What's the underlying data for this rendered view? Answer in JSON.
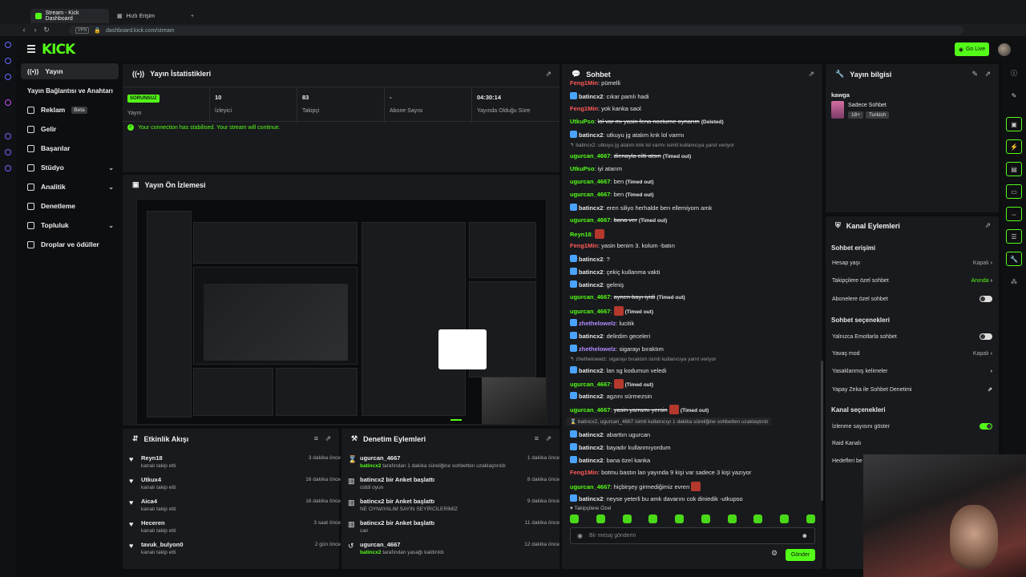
{
  "browser": {
    "tabs": [
      "Stream - Kick Dashboard",
      "Hızlı Erişim"
    ],
    "url_secure": "VPN",
    "url": "dashboard.kick.com/stream"
  },
  "header": {
    "logo": "KICK",
    "go_live": "Go Live"
  },
  "nav": {
    "items": [
      {
        "label": "Yayın",
        "active": true
      },
      {
        "label": "Yayın Bağlantısı ve Anahtarı"
      },
      {
        "label": "Reklam",
        "badge": "Beta"
      },
      {
        "label": "Gelir"
      },
      {
        "label": "Başarılar"
      },
      {
        "label": "Stüdyo"
      },
      {
        "label": "Analitik"
      },
      {
        "label": "Denetleme"
      },
      {
        "label": "Topluluk"
      },
      {
        "label": "Droplar ve ödüller"
      }
    ]
  },
  "stats": {
    "title": "Yayın İstatistikleri",
    "items": [
      {
        "value": "SORUNSUZ",
        "label": "Yayın"
      },
      {
        "value": "10",
        "label": "İzleyici"
      },
      {
        "value": "83",
        "label": "Takipçi"
      },
      {
        "value": "-",
        "label": "Abone Sayısı"
      },
      {
        "value": "04:30:14",
        "label": "Yayında Olduğu Süre"
      }
    ],
    "notice": "Your connection has stabilised. Your stream will continue."
  },
  "preview": {
    "title": "Yayın Ön İzlemesi"
  },
  "chat": {
    "title": "Sohbet",
    "messages": [
      {
        "user": "Feng1Min",
        "text": "pümelli",
        "color": "#ff5a5a"
      },
      {
        "user": "batincx2",
        "text": "cıkar pamlı hadi",
        "color": "#e5e5e5",
        "badge": true
      },
      {
        "user": "Feng1Min",
        "text": "yok kanka saol",
        "color": "#ff5a5a"
      },
      {
        "user": "UtkuPso",
        "text": "lol var mı yasin fena nocturne oynarım",
        "color": "#53fc18",
        "strike": true,
        "tag": "(Deleted)"
      },
      {
        "user": "batincx2",
        "text": "utkuyu jg atalım knk lol varmı",
        "color": "#e5e5e5",
        "badge": true
      },
      {
        "reply": "batincx2: utkuyu jg atalım knk lol varmı isimli kullanıcıya yanıt veriyor"
      },
      {
        "user": "ugurcan_4667",
        "text": "dienayla cilti atsın",
        "color": "#53fc18",
        "strike": true,
        "tag": "(Timed out)"
      },
      {
        "user": "UtkuPso",
        "text": "iyi atarım",
        "color": "#53fc18"
      },
      {
        "user": "ugurcan_4667",
        "text": "ben",
        "color": "#53fc18",
        "tag": "(Timed out)"
      },
      {
        "user": "ugurcan_4667",
        "text": "ben",
        "color": "#53fc18",
        "tag": "(Timed out)"
      },
      {
        "user": "batincx2",
        "text": "eren siliyo herhalde ben ellemiyom amk",
        "color": "#e5e5e5",
        "badge": true
      },
      {
        "user": "ugurcan_4667",
        "text": "bana ver",
        "color": "#53fc18",
        "strike": true,
        "tag": "(Timed out)"
      },
      {
        "user": "Reyn18",
        "text": "",
        "color": "#53fc18",
        "emote": true
      },
      {
        "user": "Feng1Min",
        "text": "yasin benim 3. kolum -batın",
        "color": "#ff5a5a"
      },
      {
        "user": "batincx2",
        "text": "?",
        "color": "#e5e5e5",
        "badge": true
      },
      {
        "user": "batincx2",
        "text": "çekiç kullanma vakti",
        "color": "#e5e5e5",
        "badge": true
      },
      {
        "user": "batincx2",
        "text": "gelmiş",
        "color": "#e5e5e5",
        "badge": true
      },
      {
        "user": "ugurcan_4667",
        "text": "aynen bayı iyidi",
        "color": "#53fc18",
        "strike": true,
        "tag": "(Timed out)"
      },
      {
        "user": "ugurcan_4667",
        "text": "",
        "color": "#53fc18",
        "emote": true,
        "tag": "(Timed out)"
      },
      {
        "user": "zhethelowelz",
        "text": "lucitik",
        "color": "#b48cff",
        "badge": true
      },
      {
        "user": "batincx2",
        "text": "delirdim geceleri",
        "color": "#e5e5e5",
        "badge": true
      },
      {
        "user": "zhethelowelz",
        "text": "sigarayı bıraktım",
        "color": "#b48cff",
        "badge": true
      },
      {
        "reply": "zhethelowelz: sigarayı bıraktım isimli kullanıcıya yanıt veriyor"
      },
      {
        "user": "batincx2",
        "text": "lan sg kodumun veledi",
        "color": "#e5e5e5",
        "badge": true
      },
      {
        "user": "ugurcan_4667",
        "text": "",
        "color": "#53fc18",
        "emote": true,
        "tag": "(Timed out)"
      },
      {
        "user": "batincx2",
        "text": "agzını sürmezsin",
        "color": "#e5e5e5",
        "badge": true
      },
      {
        "user": "ugurcan_4667",
        "text": "yasin yarramı yersin",
        "color": "#53fc18",
        "strike": true,
        "emote": true,
        "tag": "(Timed out)"
      },
      {
        "system": "batincx2, ugurcan_4667 isimli kullanıcıyı 1 dakika süreliğine sohbetten uzaklaştırdı"
      },
      {
        "user": "batincx2",
        "text": "abarttın ugurcan",
        "color": "#e5e5e5",
        "badge": true
      },
      {
        "user": "batincx2",
        "text": "bayadır kullanmıyordum",
        "color": "#e5e5e5",
        "badge": true
      },
      {
        "user": "batincx2",
        "text": "bana özel kanka",
        "color": "#e5e5e5",
        "badge": true
      },
      {
        "user": "Feng1Min",
        "text": "botmu bastın lan yayında 9 kişi var sadece 3 kişi yazıyor",
        "color": "#ff5a5a"
      },
      {
        "user": "ugurcan_4667",
        "text": "hiçbirşey girmediğimiz evren",
        "color": "#53fc18",
        "emote": true
      },
      {
        "user": "batincx2",
        "text": "neyse yeterli bu amk davarını cok diniedik -utkupso",
        "color": "#e5e5e5",
        "badge": true
      }
    ],
    "followers_only": "Takipçilere Özel",
    "input_placeholder": "Bir mesaj gönderin",
    "send": "Gönder"
  },
  "info": {
    "title": "Yayın bilgisi",
    "stream_title": "kawga",
    "category": "Sadece Sohbet",
    "tags": [
      "18+",
      "Turkish"
    ]
  },
  "actions": {
    "title": "Kanal Eylemleri",
    "chat_access": "Sohbet erişimi",
    "rows1": [
      {
        "label": "Hesap yaşı",
        "value": "Kapalı"
      },
      {
        "label": "Takipçilere özel sohbet",
        "value": "Anında",
        "green": true
      },
      {
        "label": "Abonelere özel sohbet",
        "toggle": false
      }
    ],
    "chat_options": "Sohbet seçenekleri",
    "rows2": [
      {
        "label": "Yalnızca Emotlarla sohbet",
        "toggle": false
      },
      {
        "label": "Yavaş mod",
        "value": "Kapalı"
      },
      {
        "label": "Yasaklanmış kelimeler",
        "value": ""
      },
      {
        "label": "Yapay Zeka ile Sohbet Denetimi",
        "value": ""
      }
    ],
    "channel_options": "Kanal seçenekleri",
    "rows3": [
      {
        "label": "İzlenme sayısını göster",
        "toggle": true
      },
      {
        "label": "Raid Kanalı"
      },
      {
        "label": "Hedefleri be"
      }
    ]
  },
  "feed": {
    "title": "Etkinlik Akışı",
    "items": [
      {
        "name": "Reyn18",
        "desc": "kanalı takip etti",
        "time": "3 dakika önce"
      },
      {
        "name": "Utkux4",
        "desc": "kanalı takip etti",
        "time": "16 dakika önce"
      },
      {
        "name": "Aica4",
        "desc": "kanalı takip etti",
        "time": "16 dakika önce"
      },
      {
        "name": "Heceren",
        "desc": "kanalı takip etti",
        "time": "3 saat önce"
      },
      {
        "name": "tavuk_bulyon0",
        "desc": "kanalı takip etti",
        "time": "2 gün önce"
      }
    ]
  },
  "moderation": {
    "title": "Denetim Eylemleri",
    "items": [
      {
        "name": "ugurcan_4667",
        "actor": "batincx2",
        "desc": "tarafından 1 dakika süreliğine sohbetten uzaklaştırıldı",
        "time": "1 dakika önce",
        "icon": "⌛"
      },
      {
        "name": "batincx2 bir Anket başlattı",
        "desc2": "ciddi oyun",
        "time": "8 dakika önce",
        "icon": "▥"
      },
      {
        "name": "batincx2 bir Anket başlattı",
        "desc2": "NE OYNAYALIM SAYIN SEYİRCİLERİMİZ",
        "time": "9 dakika önce",
        "icon": "▥"
      },
      {
        "name": "batincx2 bir Anket başlattı",
        "desc2": "can",
        "time": "11 dakika önce",
        "icon": "▥"
      },
      {
        "name": "ugurcan_4667",
        "actor": "batincx2",
        "desc": "tarafından yasağı kaldırıldı",
        "time": "12 dakika önce",
        "icon": "↺"
      }
    ]
  }
}
